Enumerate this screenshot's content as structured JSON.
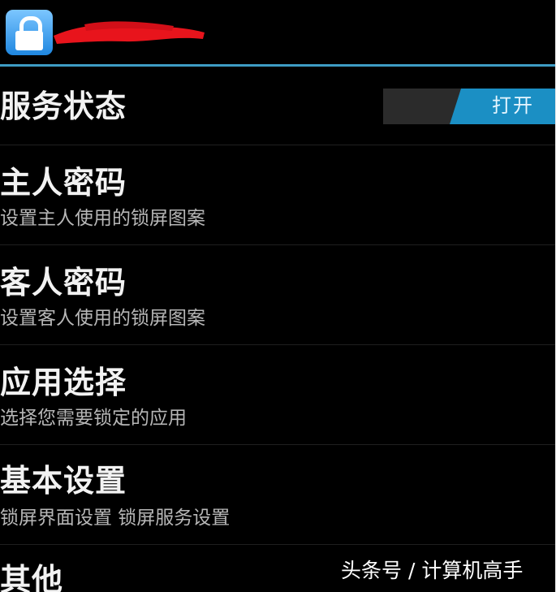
{
  "action_bar": {
    "icon": "lock-icon",
    "title_redacted": true
  },
  "settings": [
    {
      "title": "服务状态",
      "toggle": {
        "label": "打开",
        "state": "on",
        "color": "#1b8fc4"
      }
    },
    {
      "title": "主人密码",
      "summary": "设置主人使用的锁屏图案"
    },
    {
      "title": "客人密码",
      "summary": "设置客人使用的锁屏图案"
    },
    {
      "title": "应用选择",
      "summary": "选择您需要锁定的应用"
    },
    {
      "title": "基本设置",
      "summary": "锁屏界面设置  锁屏服务设置"
    },
    {
      "title": "其他"
    }
  ],
  "watermark": "头条号 / 计算机高手",
  "colors": {
    "background": "#000000",
    "accent_divider": "#3e9cc4",
    "toggle_on": "#1b8fc4",
    "redaction": "#e8141c"
  }
}
